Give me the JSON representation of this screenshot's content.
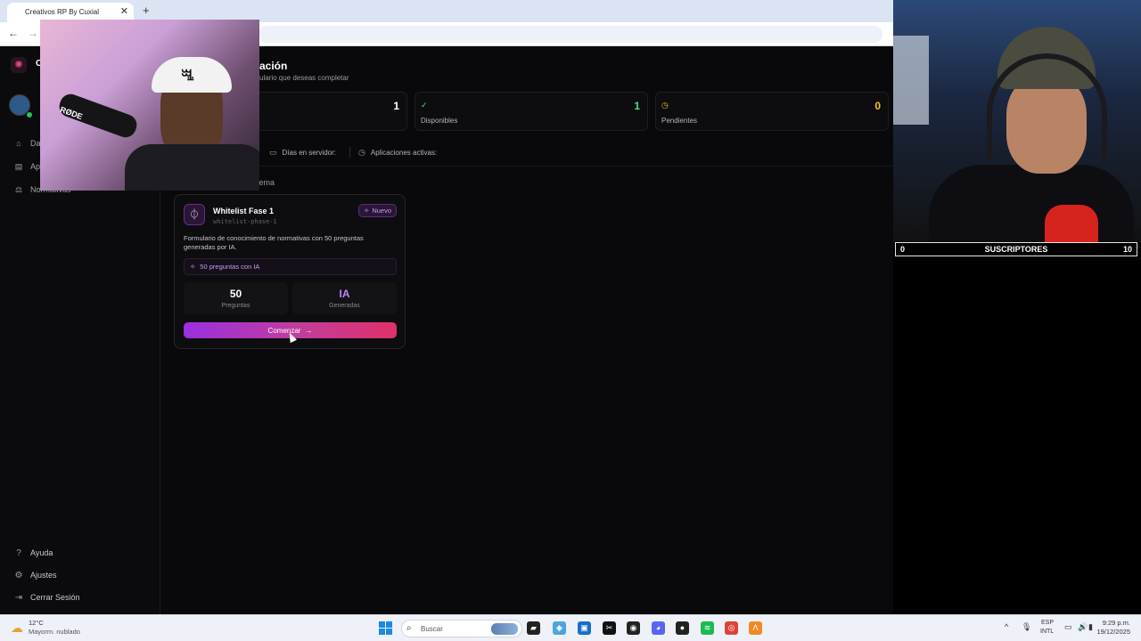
{
  "browser": {
    "tab_title": "Creativos RP By Cuxial",
    "tab_close": "✕",
    "new_tab": "+",
    "back": "←",
    "forward": "→"
  },
  "sidebar": {
    "logo_glyph": "✺",
    "brand_text": "C",
    "nav": [
      {
        "label": "Da",
        "icon": "home-icon",
        "glyph": "⌂"
      },
      {
        "label": "Ap",
        "icon": "file-icon",
        "glyph": "▤"
      },
      {
        "label": "Normativas",
        "icon": "gavel-icon",
        "glyph": "⚖"
      }
    ],
    "bottom": [
      {
        "label": "Ayuda",
        "icon": "help-icon",
        "glyph": "?"
      },
      {
        "label": "Ajustes",
        "icon": "gear-icon",
        "glyph": "⚙"
      },
      {
        "label": "Cerrar Sesión",
        "icon": "logout-icon",
        "glyph": "⇥"
      }
    ]
  },
  "main": {
    "title": "ación",
    "subtitle": "ulario que deseas completar",
    "stats": [
      {
        "label": "",
        "value": "1",
        "icon": "",
        "color": "#ffffff"
      },
      {
        "label": "Disponibles",
        "value": "1",
        "icon": "check-circle-icon",
        "glyph": "✓",
        "color": "#4ade80"
      },
      {
        "label": "Pendientes",
        "value": "0",
        "icon": "clock-icon",
        "glyph": "◷",
        "color": "#fbbf24"
      }
    ],
    "info": {
      "days_label": "Días en servidor:",
      "days_icon": "▭",
      "apps_label": "Aplicaciones activas:",
      "apps_icon": "◷"
    },
    "section_label": "tema",
    "form": {
      "icon_glyph": "⏀",
      "title": "Whitelist Fase 1",
      "slug": "whitelist-phase-1",
      "badge": "Nuevo",
      "badge_glyph": "✧",
      "description": "Formulario de conocimiento de normativas con 50 preguntas generadas por IA.",
      "ai_strip": "50 preguntas con IA",
      "ai_glyph": "✧",
      "stats": [
        {
          "value": "50",
          "label": "Preguntas",
          "color": "#ffffff"
        },
        {
          "value": "IA",
          "label": "Generadas",
          "color": "#c084fc"
        }
      ],
      "button": "Comenzar",
      "button_arrow": "→"
    }
  },
  "overlay": {
    "cam_left_logo": "ꗆ",
    "cam_left_mic": "RØDE",
    "sub_left": "0",
    "sub_title": "SUSCRIPTORES",
    "sub_right": "10"
  },
  "taskbar": {
    "weather_icon": "☁",
    "temp": "12°C",
    "weather": "Mayorm. nublado",
    "search_icon": "⌕",
    "search_placeholder": "Buscar",
    "apps": [
      {
        "name": "file-explorer-icon",
        "glyph": "▰",
        "color": "#222222"
      },
      {
        "name": "copilot-icon",
        "glyph": "◆",
        "color": "#4fa3e0"
      },
      {
        "name": "store-icon",
        "glyph": "▣",
        "color": "#1a6fc4"
      },
      {
        "name": "capcut-icon",
        "glyph": "✂",
        "color": "#111111"
      },
      {
        "name": "obs-icon",
        "glyph": "◉",
        "color": "#222222"
      },
      {
        "name": "discord-icon",
        "glyph": "◕",
        "color": "#5865f2"
      },
      {
        "name": "github-icon",
        "glyph": "●",
        "color": "#222222"
      },
      {
        "name": "spotify-icon",
        "glyph": "≋",
        "color": "#1db954"
      },
      {
        "name": "chrome-icon",
        "glyph": "◎",
        "color": "#db4437"
      },
      {
        "name": "app-a-icon",
        "glyph": "Λ",
        "color": "#f08a24"
      }
    ],
    "tray_caret": "^",
    "tray_mic": "🎙",
    "lang_1": "ESP",
    "lang_2": "INTL",
    "tray_net": "▭",
    "tray_vol": "🔊",
    "tray_bat": "▮",
    "time": "9:29 p.m.",
    "date": "19/12/2025"
  }
}
